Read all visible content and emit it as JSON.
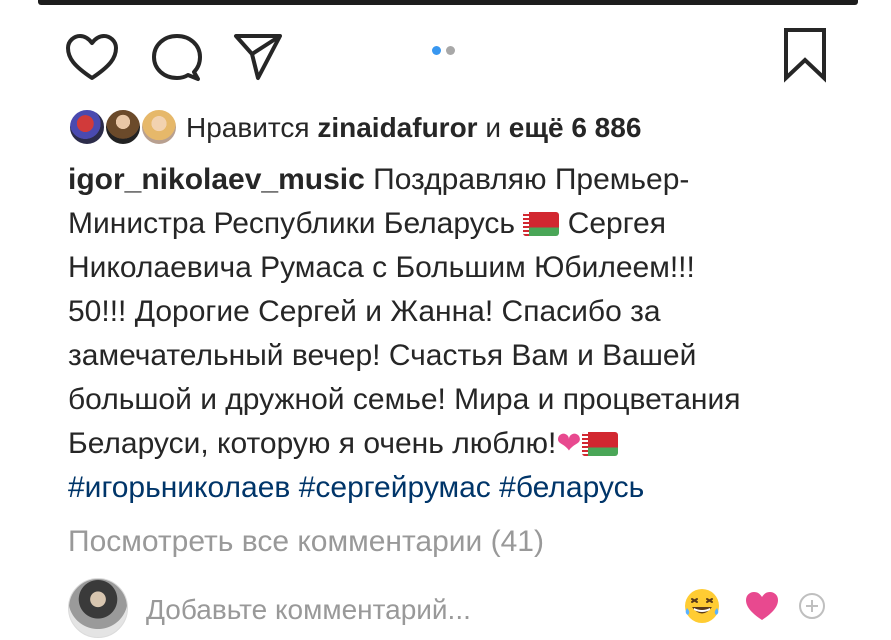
{
  "post": {
    "likes": {
      "prefix": "Нравится",
      "user": "zinaidafuror",
      "conj": "и",
      "more": "ещё 6 886"
    },
    "caption": {
      "username": "igor_nikolaev_music",
      "line1": "Поздравляю Премьер-",
      "line2a": "Министра Республики Беларусь",
      "line2b": "Сергея",
      "line3": "Николаевича Румаса с Большим Юбилеем!!!",
      "line4": "50!!! Дорогие Сергей и Жанна! Спасибо за",
      "line5": "замечательный вечер! Счастья Вам и Вашей",
      "line6": "большой и дружной семье! Мира и процветания",
      "line7": "Беларуси, которую я очень люблю!",
      "heart_emoji": "❤",
      "hashtags": [
        "#игорьниколаев",
        "#сергейрумас",
        "#беларусь"
      ]
    },
    "view_comments": "Посмотреть все комментарии (41)",
    "comment_input": {
      "placeholder": "Добавьте комментарий..."
    },
    "carousel": {
      "total": 2,
      "active": 1
    }
  },
  "icons": {
    "like": "heart-outline-icon",
    "comment": "comment-bubble-icon",
    "share": "paper-plane-icon",
    "save": "bookmark-icon",
    "laugh": "laughing-emoji-icon",
    "heart": "heart-emoji-icon",
    "add": "plus-circle-icon"
  },
  "colors": {
    "hashtag": "#003569",
    "muted": "#999999",
    "dot_active": "#3897f0",
    "heart": "#e8498f"
  }
}
